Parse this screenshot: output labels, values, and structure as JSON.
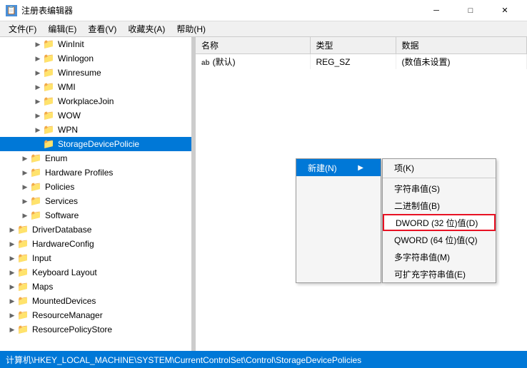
{
  "titleBar": {
    "icon": "🗂",
    "title": "注册表编辑器",
    "minimizeBtn": "─",
    "maximizeBtn": "□",
    "closeBtn": "✕"
  },
  "menuBar": {
    "items": [
      "文件(F)",
      "编辑(E)",
      "查看(V)",
      "收藏夹(A)",
      "帮助(H)"
    ]
  },
  "treeItems": [
    {
      "indent": 2,
      "hasArrow": true,
      "arrowOpen": false,
      "label": "WinInit"
    },
    {
      "indent": 2,
      "hasArrow": true,
      "arrowOpen": false,
      "label": "Winlogon"
    },
    {
      "indent": 2,
      "hasArrow": true,
      "arrowOpen": false,
      "label": "Winresume"
    },
    {
      "indent": 2,
      "hasArrow": true,
      "arrowOpen": false,
      "label": "WMI"
    },
    {
      "indent": 2,
      "hasArrow": true,
      "arrowOpen": false,
      "label": "WorkplaceJoin"
    },
    {
      "indent": 2,
      "hasArrow": true,
      "arrowOpen": false,
      "label": "WOW"
    },
    {
      "indent": 2,
      "hasArrow": true,
      "arrowOpen": false,
      "label": "WPN"
    },
    {
      "indent": 2,
      "hasArrow": false,
      "arrowOpen": false,
      "label": "StorageDevicePolicie",
      "selected": true
    },
    {
      "indent": 1,
      "hasArrow": true,
      "arrowOpen": false,
      "label": "Enum"
    },
    {
      "indent": 1,
      "hasArrow": true,
      "arrowOpen": false,
      "label": "Hardware Profiles"
    },
    {
      "indent": 1,
      "hasArrow": true,
      "arrowOpen": false,
      "label": "Policies"
    },
    {
      "indent": 1,
      "hasArrow": true,
      "arrowOpen": false,
      "label": "Services"
    },
    {
      "indent": 1,
      "hasArrow": true,
      "arrowOpen": false,
      "label": "Software"
    },
    {
      "indent": 0,
      "hasArrow": true,
      "arrowOpen": false,
      "label": "DriverDatabase"
    },
    {
      "indent": 0,
      "hasArrow": true,
      "arrowOpen": false,
      "label": "HardwareConfig"
    },
    {
      "indent": 0,
      "hasArrow": true,
      "arrowOpen": false,
      "label": "Input"
    },
    {
      "indent": 0,
      "hasArrow": true,
      "arrowOpen": false,
      "label": "Keyboard Layout"
    },
    {
      "indent": 0,
      "hasArrow": true,
      "arrowOpen": false,
      "label": "Maps"
    },
    {
      "indent": 0,
      "hasArrow": true,
      "arrowOpen": false,
      "label": "MountedDevices"
    },
    {
      "indent": 0,
      "hasArrow": true,
      "arrowOpen": false,
      "label": "ResourceManager"
    },
    {
      "indent": 0,
      "hasArrow": true,
      "arrowOpen": false,
      "label": "ResourcePolicyStore"
    }
  ],
  "tableHeaders": [
    "名称",
    "类型",
    "数据"
  ],
  "tableRows": [
    {
      "name": "(默认)",
      "namePrefix": "ab",
      "type": "REG_SZ",
      "data": "(数值未设置)"
    }
  ],
  "contextMenu": {
    "triggerLabel": "新建(N)",
    "triggerArrow": "▶",
    "items": [
      {
        "label": "项(K)",
        "hasArrow": false
      },
      {
        "separator": true
      },
      {
        "label": "字符串值(S)",
        "hasArrow": false
      },
      {
        "label": "二进制值(B)",
        "hasArrow": false
      },
      {
        "label": "DWORD (32 位)值(D)",
        "hasArrow": false,
        "highlighted": true
      },
      {
        "label": "QWORD (64 位)值(Q)",
        "hasArrow": false
      },
      {
        "label": "多字符串值(M)",
        "hasArrow": false
      },
      {
        "label": "可扩充字符串值(E)",
        "hasArrow": false
      }
    ]
  },
  "statusBar": {
    "text": "计算机\\HKEY_LOCAL_MACHINE\\SYSTEM\\CurrentControlSet\\Control\\StorageDevicePolicies"
  }
}
